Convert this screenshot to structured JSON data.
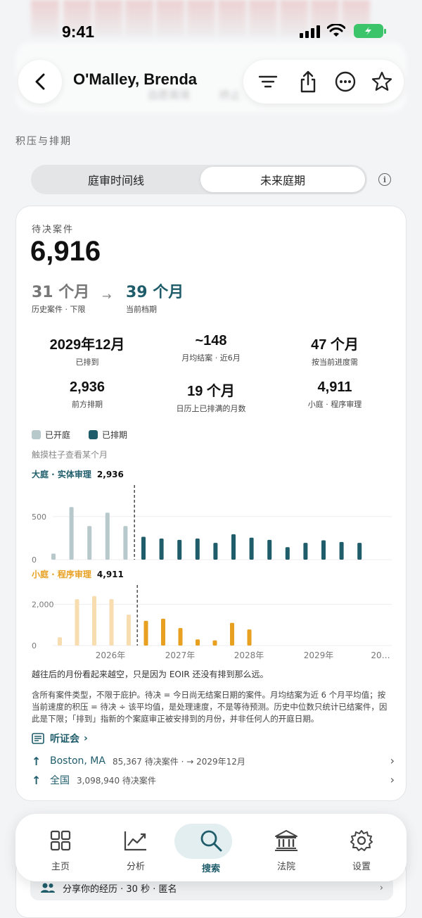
{
  "status": {
    "time": "9:41"
  },
  "header": {
    "title": "O'Malley, Brenda"
  },
  "background_peek": {
    "left_text": "自愿离境",
    "right_text": "终止"
  },
  "section": {
    "label": "积压与排期"
  },
  "segmented": {
    "options": [
      "庭审时间线",
      "未来庭期"
    ],
    "active_index": 1
  },
  "summary": {
    "pending_label": "待决案件",
    "pending_value": "6,916",
    "historical_value": "31 个月",
    "historical_label": "历史案件 · 下限",
    "current_value": "39 个月",
    "current_label": "当前档期"
  },
  "stats": [
    {
      "value": "2029年12月",
      "label": "已排到"
    },
    {
      "value": "~148",
      "label": "月均结案 · 近6月"
    },
    {
      "value": "47 个月",
      "label": "按当前进度需"
    },
    {
      "value": "2,936",
      "label": "前方排期"
    },
    {
      "value": "19 个月",
      "label": "日历上已排满的月数"
    },
    {
      "value": "4,911",
      "label": "小庭 · 程序审理"
    }
  ],
  "legend": {
    "opened": "已开庭",
    "scheduled": "已排期"
  },
  "hint": "触摸柱子查看某个月",
  "colors": {
    "teal": "#1f5d6b",
    "teal_light": "#b8c9cc",
    "orange": "#e8a020",
    "orange_light": "#f7ddb0"
  },
  "chart_data": [
    {
      "type": "bar",
      "title": "大庭 · 实体审理",
      "total": "2,936",
      "y_ticks": [
        "500",
        "0"
      ],
      "ylim": [
        0,
        800
      ],
      "values": [
        70,
        610,
        390,
        545,
        390,
        265,
        245,
        230,
        245,
        195,
        295,
        255,
        230,
        145,
        195,
        225,
        205,
        195
      ],
      "opened_count": 5,
      "grid": true
    },
    {
      "type": "bar",
      "title": "小庭 · 程序审理",
      "total": "4,911",
      "y_ticks": [
        "2,000",
        "0"
      ],
      "ylim": [
        0,
        2800
      ],
      "values": [
        400,
        2250,
        2400,
        2250,
        1500,
        1200,
        1300,
        850,
        300,
        250,
        1100,
        780
      ],
      "opened_count": 5,
      "x_ticks": [
        "2026年",
        "2027年",
        "2028年",
        "2029年",
        "20…"
      ],
      "grid": true
    }
  ],
  "notes": {
    "line1": "越往后的月份看起来越空，只是因为 EOIR 还没有排到那么远。",
    "line2": "含所有案件类型，不限于庇护。待决 = 今日尚无结案日期的案件。月均结案为近 6 个月平均值；按当前速度的积压 = 待决 ÷ 该平均值，是处理速度，不是等待预测。历史中位数只统计已结案件，因此是下限；「排到」指新的个案庭审正被安排到的月份，并非任何人的开庭日期。"
  },
  "links": {
    "hearings": "听证会",
    "rows": [
      {
        "name": "Boston, MA",
        "detail": "85,367 待决案件 · → 2029年12月"
      },
      {
        "name": "全国",
        "detail": "3,098,940 待决案件"
      }
    ]
  },
  "peek_bottom": {
    "text": "分享你的经历 · 30 秒 · 匿名"
  },
  "tabs": [
    {
      "label": "主页",
      "icon": "grid-icon"
    },
    {
      "label": "分析",
      "icon": "chart-icon"
    },
    {
      "label": "搜索",
      "icon": "search-icon"
    },
    {
      "label": "法院",
      "icon": "courthouse-icon"
    },
    {
      "label": "设置",
      "icon": "gear-icon"
    }
  ],
  "active_tab": 2
}
